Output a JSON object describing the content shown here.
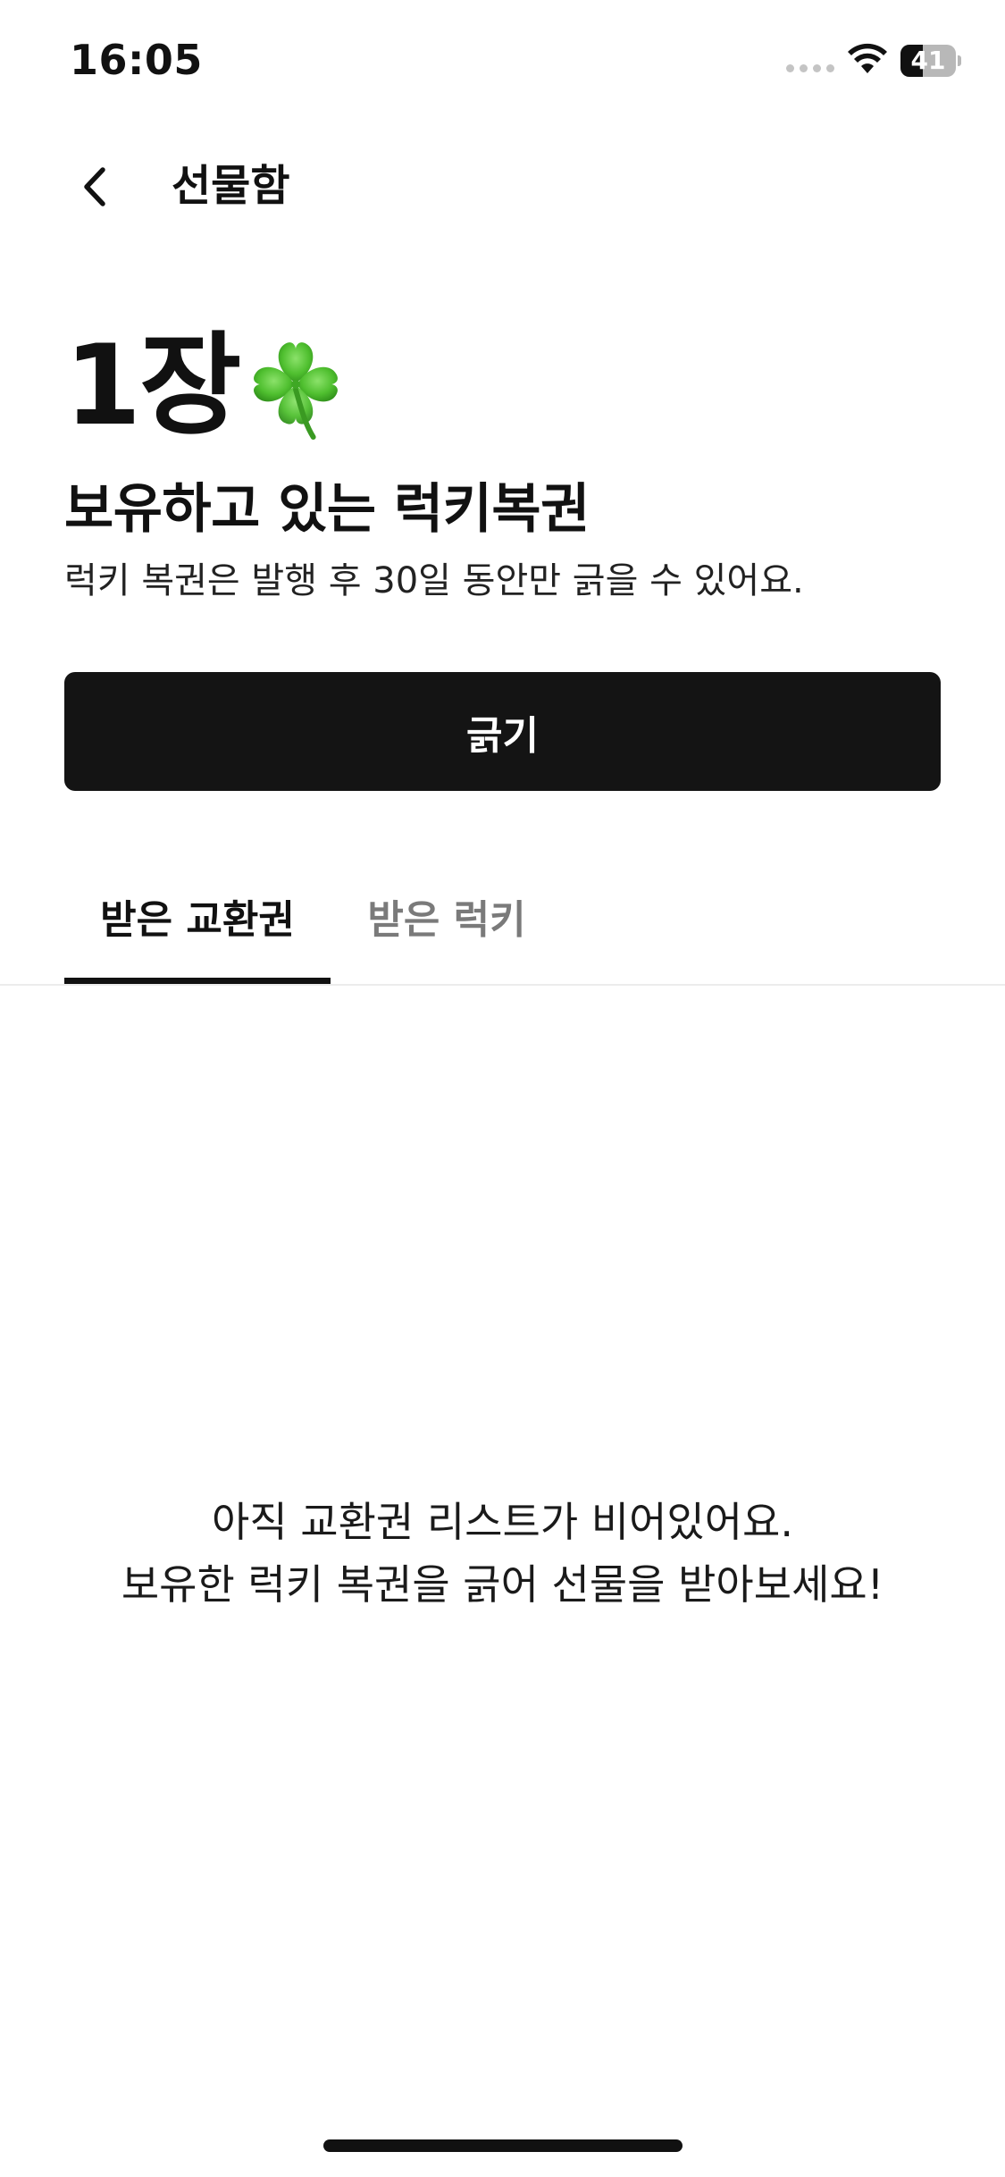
{
  "status_bar": {
    "time": "16:05",
    "battery_percent": 41,
    "battery_label": "41",
    "icons": [
      "signal-dots-icon",
      "wifi-icon",
      "battery-icon"
    ]
  },
  "nav": {
    "back_icon": "chevron-left-icon",
    "title": "선물함"
  },
  "header": {
    "ticket_count": "1장",
    "count_emoji": "four-leaf-clover-icon",
    "heading": "보유하고 있는 럭키복권",
    "description": "럭키 복권은 발행 후 30일 동안만 긁을 수 있어요."
  },
  "primary_action": {
    "label": "긁기"
  },
  "tabs": [
    {
      "label": "받은 교환권",
      "selected": true
    },
    {
      "label": "받은 럭키",
      "selected": false
    }
  ],
  "empty_state": {
    "line1": "아직 교환권 리스트가 비어있어요.",
    "line2": "보유한 럭키 복권을 긁어 선물을 받아보세요!"
  },
  "colors": {
    "text": "#111111",
    "button_bg": "#141414",
    "button_text": "#ffffff",
    "tab_inactive": "#7a7a7a",
    "clover_green": "#4fbf2f",
    "divider": "#ececec"
  }
}
